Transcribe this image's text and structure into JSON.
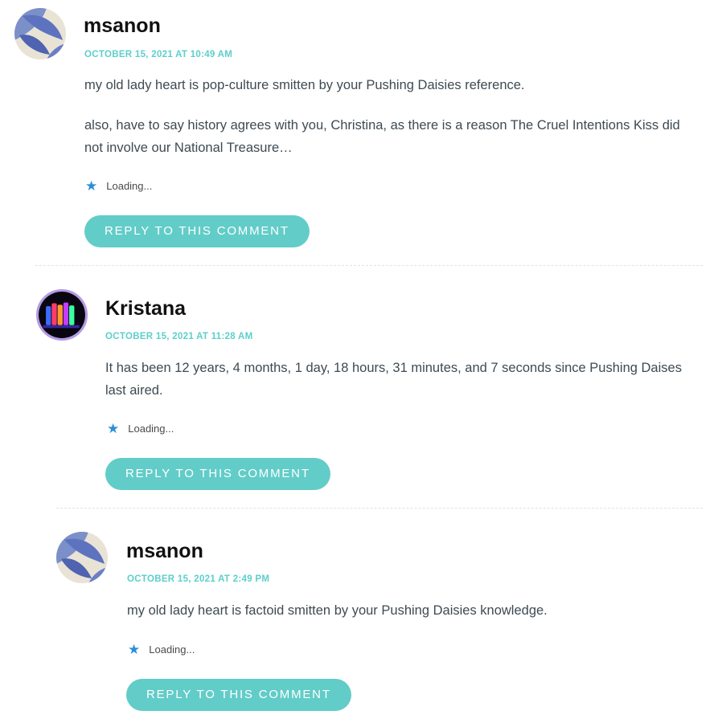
{
  "comments": [
    {
      "author": "msanon",
      "date": "OCTOBER 15, 2021 AT 10:49 AM",
      "paragraphs": [
        "my old lady heart is pop-culture smitten by your Pushing Daisies reference.",
        "also, have to say history agrees with you, Christina, as there is a reason The Cruel Intentions Kiss did not involve our National Treasure…"
      ],
      "likes": "Loading...",
      "reply_label": "REPLY TO THIS COMMENT"
    },
    {
      "author": "Kristana",
      "date": "OCTOBER 15, 2021 AT 11:28 AM",
      "paragraphs": [
        "It has been 12 years, 4 months, 1 day, 18 hours, 31 minutes, and 7 seconds since Pushing Daises last aired."
      ],
      "likes": "Loading...",
      "reply_label": "REPLY TO THIS COMMENT"
    },
    {
      "author": "msanon",
      "date": "OCTOBER 15, 2021 AT 2:49 PM",
      "paragraphs": [
        "my old lady heart is factoid smitten by your Pushing Daisies knowledge."
      ],
      "likes": "Loading...",
      "reply_label": "REPLY TO THIS COMMENT"
    }
  ],
  "icons": {
    "like": "star-icon",
    "avatar_msanon": "flower-avatar",
    "avatar_kristana": "bottles-avatar"
  },
  "colors": {
    "accent": "#62ccc8",
    "date": "#5ccfcb",
    "star": "#2a8fd6",
    "avatar_ring": "#b59ae8"
  }
}
